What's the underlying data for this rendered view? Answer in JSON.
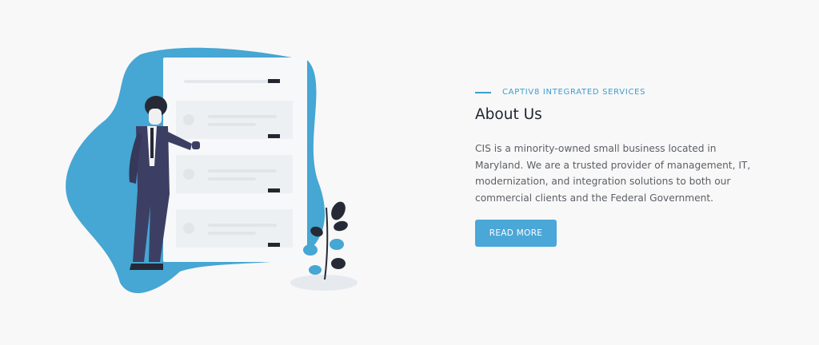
{
  "about": {
    "eyebrow": "CAPTIV8 INTEGRATED SERVICES",
    "title": "About Us",
    "description": "CIS is a minority-owned small business located in Maryland. We are a trusted provider of management, IT, modernization, and integration solutions to both our commercial clients and the Federal Government.",
    "button_label": "READ MORE"
  },
  "colors": {
    "accent": "#3d9dd0",
    "blob": "#46a6d4",
    "button": "#4aa7d7",
    "heading": "#202632",
    "body_text": "#5b5f66",
    "background": "#f8f8f8"
  },
  "illustration": {
    "icons": [
      "blob-background",
      "document-panel",
      "businessman-figure",
      "plant-icon"
    ]
  }
}
